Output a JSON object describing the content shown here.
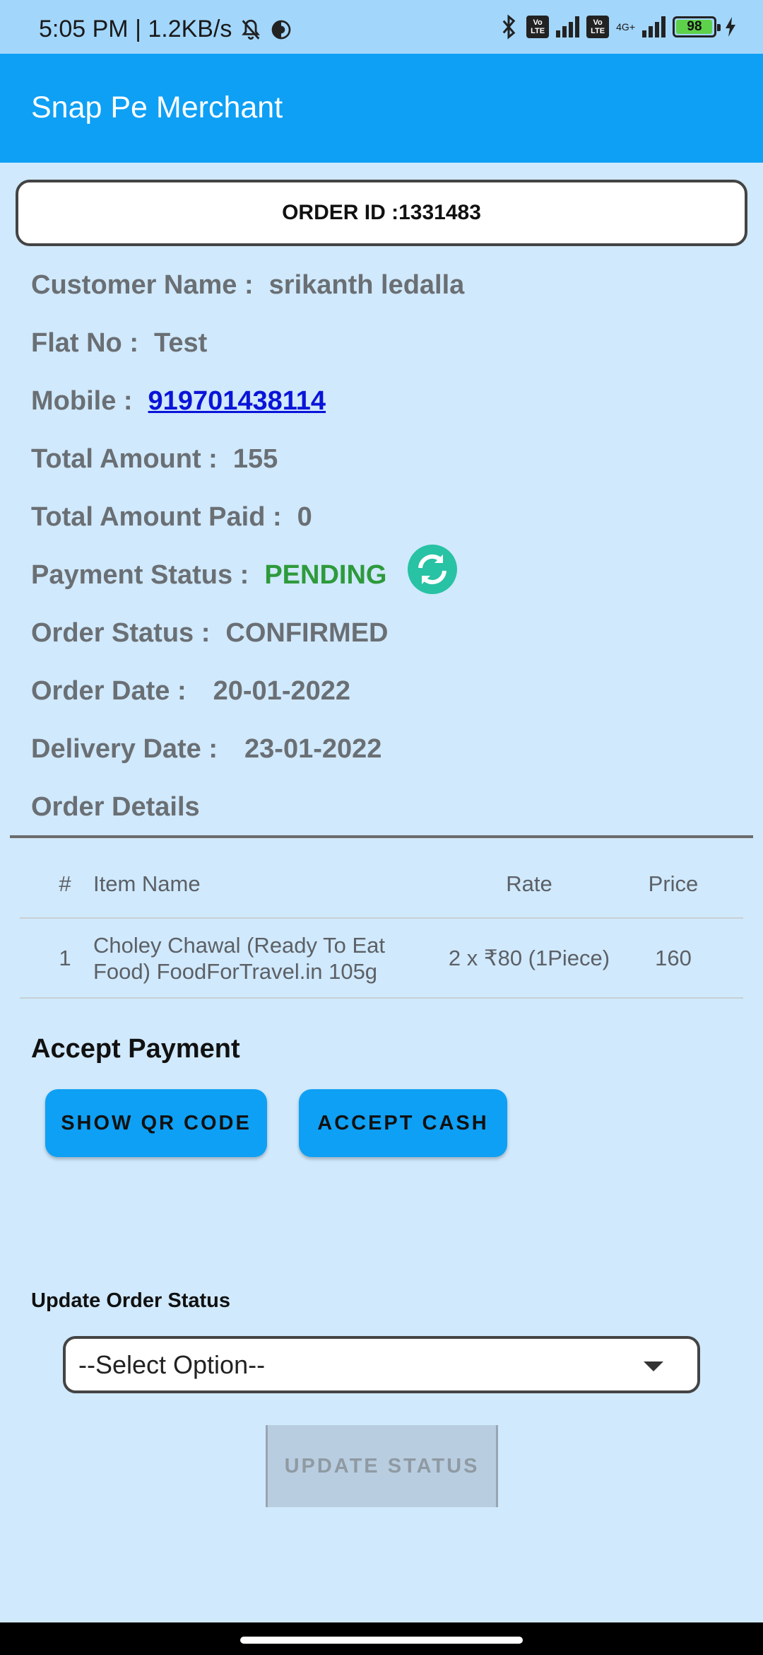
{
  "status_bar": {
    "time_speed": "5:05 PM | 1.2KB/s",
    "network": "4G+",
    "volte": "Vo LTE",
    "battery": "98"
  },
  "app": {
    "title": "Snap Pe Merchant"
  },
  "order": {
    "id_label": "ORDER ID :1331483",
    "customer_label": "Customer Name :",
    "customer_value": "srikanth ledalla",
    "flat_label": "Flat No :",
    "flat_value": "Test",
    "mobile_label": "Mobile :",
    "mobile_value": "919701438114",
    "total_label": "Total Amount :",
    "total_value": "155",
    "paid_label": "Total Amount Paid :",
    "paid_value": "0",
    "payment_status_label": "Payment Status :",
    "payment_status_value": "PENDING",
    "order_status_label": "Order Status :",
    "order_status_value": "CONFIRMED",
    "order_date_label": "Order Date :",
    "order_date_value": "20-01-2022",
    "delivery_date_label": "Delivery Date :",
    "delivery_date_value": "23-01-2022",
    "details_heading": "Order Details"
  },
  "table": {
    "headers": {
      "num": "#",
      "name": "Item Name",
      "rate": "Rate",
      "price": "Price"
    },
    "rows": [
      {
        "num": "1",
        "name": "Choley Chawal (Ready To Eat Food) FoodForTravel.in 105g",
        "rate": "2 x ₹80 (1Piece)",
        "price": "160"
      }
    ]
  },
  "payment": {
    "heading": "Accept Payment",
    "qr_button": "SHOW QR CODE",
    "cash_button": "ACCEPT CASH"
  },
  "update": {
    "label": "Update Order Status",
    "select_value": "--Select Option--",
    "button": "UPDATE STATUS"
  },
  "colors": {
    "background": "#d0e9fc",
    "app_bar": "#0ea0f5",
    "pending": "#2e9a3c",
    "link": "#0a14d8"
  }
}
